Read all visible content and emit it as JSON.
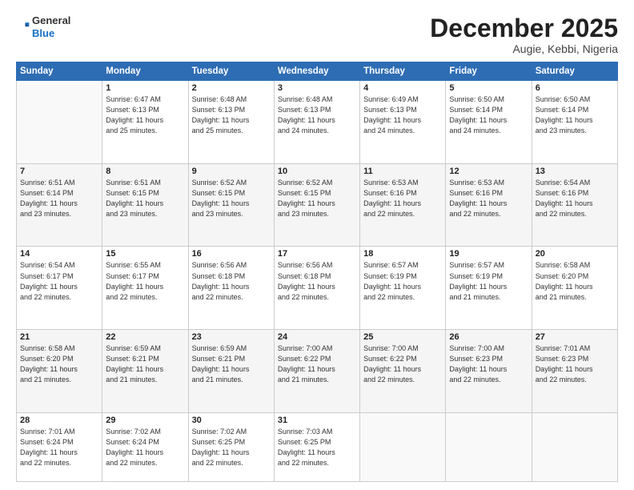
{
  "header": {
    "logo_line1": "General",
    "logo_line2": "Blue",
    "month_title": "December 2025",
    "location": "Augie, Kebbi, Nigeria"
  },
  "weekdays": [
    "Sunday",
    "Monday",
    "Tuesday",
    "Wednesday",
    "Thursday",
    "Friday",
    "Saturday"
  ],
  "weeks": [
    [
      {
        "day": "",
        "info": ""
      },
      {
        "day": "1",
        "info": "Sunrise: 6:47 AM\nSunset: 6:13 PM\nDaylight: 11 hours\nand 25 minutes."
      },
      {
        "day": "2",
        "info": "Sunrise: 6:48 AM\nSunset: 6:13 PM\nDaylight: 11 hours\nand 25 minutes."
      },
      {
        "day": "3",
        "info": "Sunrise: 6:48 AM\nSunset: 6:13 PM\nDaylight: 11 hours\nand 24 minutes."
      },
      {
        "day": "4",
        "info": "Sunrise: 6:49 AM\nSunset: 6:13 PM\nDaylight: 11 hours\nand 24 minutes."
      },
      {
        "day": "5",
        "info": "Sunrise: 6:50 AM\nSunset: 6:14 PM\nDaylight: 11 hours\nand 24 minutes."
      },
      {
        "day": "6",
        "info": "Sunrise: 6:50 AM\nSunset: 6:14 PM\nDaylight: 11 hours\nand 23 minutes."
      }
    ],
    [
      {
        "day": "7",
        "info": "Sunrise: 6:51 AM\nSunset: 6:14 PM\nDaylight: 11 hours\nand 23 minutes."
      },
      {
        "day": "8",
        "info": "Sunrise: 6:51 AM\nSunset: 6:15 PM\nDaylight: 11 hours\nand 23 minutes."
      },
      {
        "day": "9",
        "info": "Sunrise: 6:52 AM\nSunset: 6:15 PM\nDaylight: 11 hours\nand 23 minutes."
      },
      {
        "day": "10",
        "info": "Sunrise: 6:52 AM\nSunset: 6:15 PM\nDaylight: 11 hours\nand 23 minutes."
      },
      {
        "day": "11",
        "info": "Sunrise: 6:53 AM\nSunset: 6:16 PM\nDaylight: 11 hours\nand 22 minutes."
      },
      {
        "day": "12",
        "info": "Sunrise: 6:53 AM\nSunset: 6:16 PM\nDaylight: 11 hours\nand 22 minutes."
      },
      {
        "day": "13",
        "info": "Sunrise: 6:54 AM\nSunset: 6:16 PM\nDaylight: 11 hours\nand 22 minutes."
      }
    ],
    [
      {
        "day": "14",
        "info": "Sunrise: 6:54 AM\nSunset: 6:17 PM\nDaylight: 11 hours\nand 22 minutes."
      },
      {
        "day": "15",
        "info": "Sunrise: 6:55 AM\nSunset: 6:17 PM\nDaylight: 11 hours\nand 22 minutes."
      },
      {
        "day": "16",
        "info": "Sunrise: 6:56 AM\nSunset: 6:18 PM\nDaylight: 11 hours\nand 22 minutes."
      },
      {
        "day": "17",
        "info": "Sunrise: 6:56 AM\nSunset: 6:18 PM\nDaylight: 11 hours\nand 22 minutes."
      },
      {
        "day": "18",
        "info": "Sunrise: 6:57 AM\nSunset: 6:19 PM\nDaylight: 11 hours\nand 22 minutes."
      },
      {
        "day": "19",
        "info": "Sunrise: 6:57 AM\nSunset: 6:19 PM\nDaylight: 11 hours\nand 21 minutes."
      },
      {
        "day": "20",
        "info": "Sunrise: 6:58 AM\nSunset: 6:20 PM\nDaylight: 11 hours\nand 21 minutes."
      }
    ],
    [
      {
        "day": "21",
        "info": "Sunrise: 6:58 AM\nSunset: 6:20 PM\nDaylight: 11 hours\nand 21 minutes."
      },
      {
        "day": "22",
        "info": "Sunrise: 6:59 AM\nSunset: 6:21 PM\nDaylight: 11 hours\nand 21 minutes."
      },
      {
        "day": "23",
        "info": "Sunrise: 6:59 AM\nSunset: 6:21 PM\nDaylight: 11 hours\nand 21 minutes."
      },
      {
        "day": "24",
        "info": "Sunrise: 7:00 AM\nSunset: 6:22 PM\nDaylight: 11 hours\nand 21 minutes."
      },
      {
        "day": "25",
        "info": "Sunrise: 7:00 AM\nSunset: 6:22 PM\nDaylight: 11 hours\nand 22 minutes."
      },
      {
        "day": "26",
        "info": "Sunrise: 7:00 AM\nSunset: 6:23 PM\nDaylight: 11 hours\nand 22 minutes."
      },
      {
        "day": "27",
        "info": "Sunrise: 7:01 AM\nSunset: 6:23 PM\nDaylight: 11 hours\nand 22 minutes."
      }
    ],
    [
      {
        "day": "28",
        "info": "Sunrise: 7:01 AM\nSunset: 6:24 PM\nDaylight: 11 hours\nand 22 minutes."
      },
      {
        "day": "29",
        "info": "Sunrise: 7:02 AM\nSunset: 6:24 PM\nDaylight: 11 hours\nand 22 minutes."
      },
      {
        "day": "30",
        "info": "Sunrise: 7:02 AM\nSunset: 6:25 PM\nDaylight: 11 hours\nand 22 minutes."
      },
      {
        "day": "31",
        "info": "Sunrise: 7:03 AM\nSunset: 6:25 PM\nDaylight: 11 hours\nand 22 minutes."
      },
      {
        "day": "",
        "info": ""
      },
      {
        "day": "",
        "info": ""
      },
      {
        "day": "",
        "info": ""
      }
    ]
  ]
}
